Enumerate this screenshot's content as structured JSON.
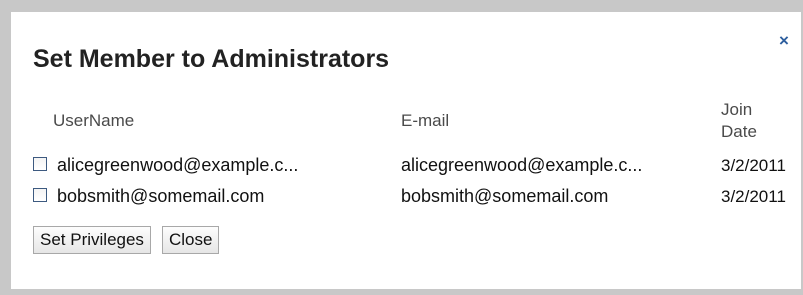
{
  "dialog": {
    "title": "Set Member to Administrators",
    "close_symbol": "×"
  },
  "table": {
    "headers": {
      "username": "UserName",
      "email": "E-mail",
      "join_date_line1": "Join",
      "join_date_line2": "Date"
    },
    "rows": [
      {
        "username": "alicegreenwood@example.c...",
        "email": "alicegreenwood@example.c...",
        "join_date": "3/2/2011",
        "checked": false
      },
      {
        "username": "bobsmith@somemail.com",
        "email": "bobsmith@somemail.com",
        "join_date": "3/2/2011",
        "checked": false
      }
    ]
  },
  "buttons": {
    "set_privileges": "Set Privileges",
    "close": "Close"
  },
  "colors": {
    "overlay": "#c8c8c8",
    "dialog_bg": "#ffffff",
    "close_icon": "#2d5e9e"
  }
}
